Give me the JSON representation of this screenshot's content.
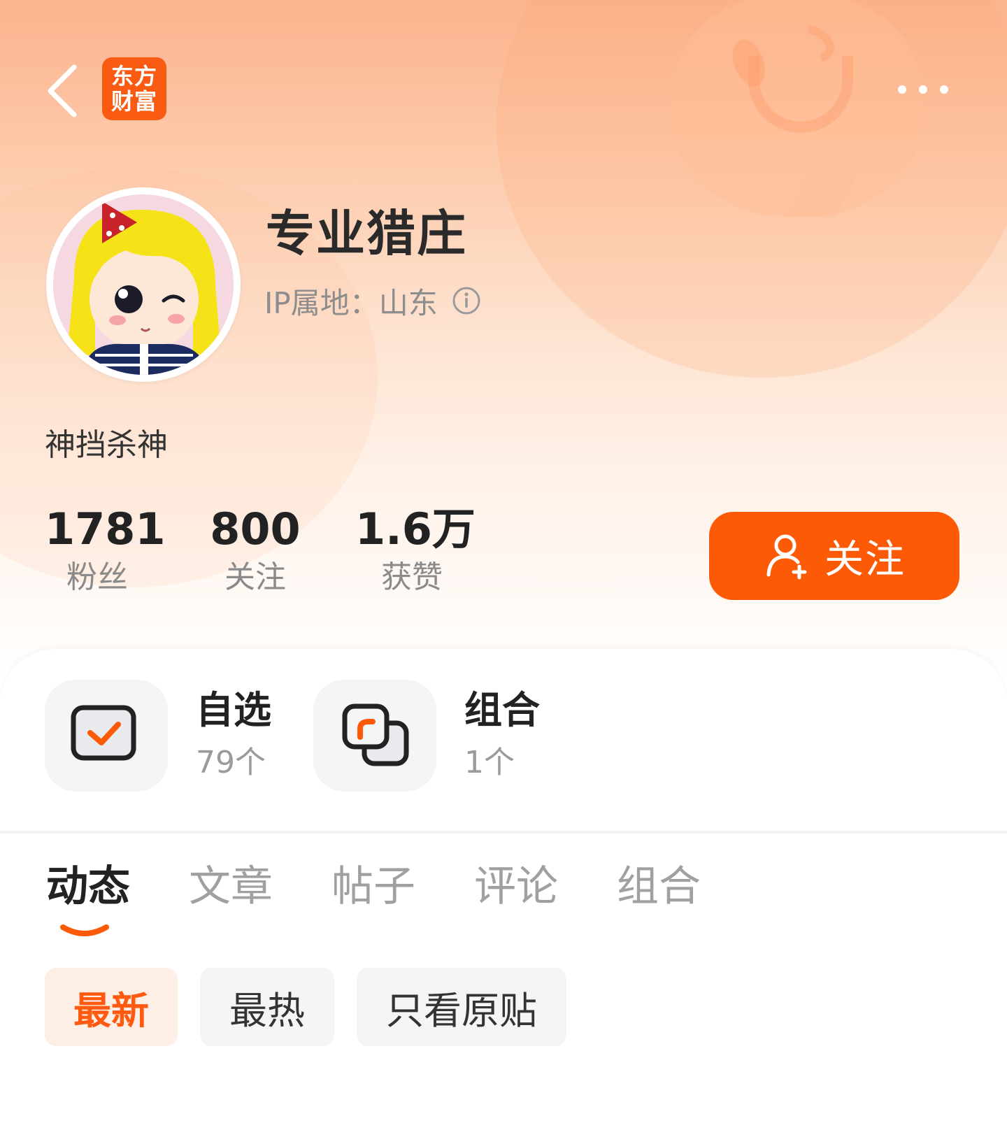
{
  "header": {
    "logo_line1": "东方",
    "logo_line2": "财富",
    "back_icon": "chevron-left-icon",
    "more_icon": "more-dots-icon"
  },
  "profile": {
    "username": "专业猎庄",
    "ip_location": "IP属地：山东",
    "bio": "神挡杀神"
  },
  "stats": [
    {
      "value": "1781",
      "label": "粉丝"
    },
    {
      "value": "800",
      "label": "关注"
    },
    {
      "value": "1.6万",
      "label": "获赞"
    }
  ],
  "follow_button": {
    "label": "关注",
    "icon": "add-user-icon"
  },
  "quick_links": [
    {
      "title": "自选",
      "count": "79个",
      "icon": "watchlist-check-icon"
    },
    {
      "title": "组合",
      "count": "1个",
      "icon": "portfolio-icon"
    }
  ],
  "tabs": [
    "动态",
    "文章",
    "帖子",
    "评论",
    "组合"
  ],
  "active_tab": "动态",
  "filters": [
    "最新",
    "最热",
    "只看原贴"
  ],
  "active_filter": "最新",
  "colors": {
    "accent": "#fd5a07",
    "logo": "#fa5b12",
    "active_chip_bg": "#fdeee6"
  }
}
